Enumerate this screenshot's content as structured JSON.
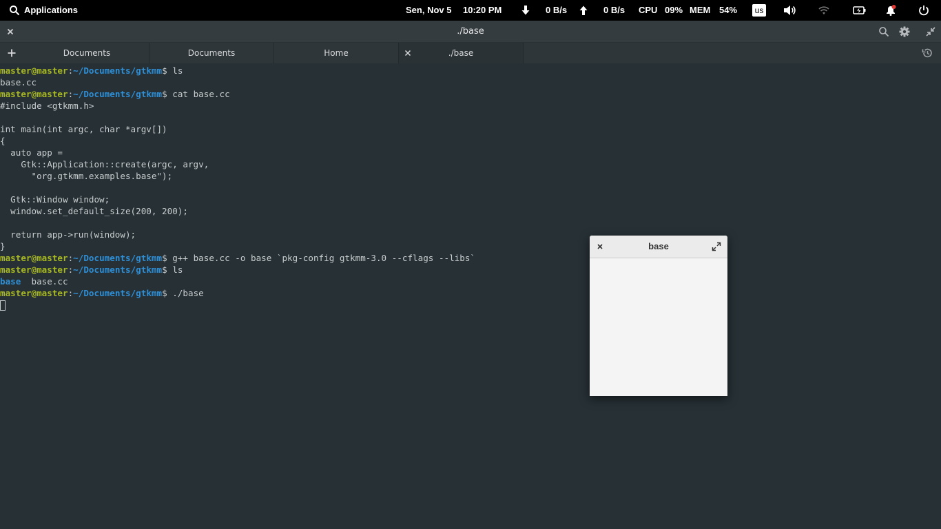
{
  "panel": {
    "applications_label": "Applications",
    "date": "Sen, Nov  5",
    "time": "10:20 PM",
    "download_rate": "0  B/s",
    "upload_rate": "0  B/s",
    "cpu_label": "CPU",
    "cpu_value": "09%",
    "mem_label": "MEM",
    "mem_value": "54%",
    "keyboard_layout": "us"
  },
  "terminal_window": {
    "title": "./base",
    "tabs": [
      {
        "label": "Documents"
      },
      {
        "label": "Documents"
      },
      {
        "label": "Home"
      },
      {
        "label": "./base"
      }
    ]
  },
  "terminal": {
    "user": "master@master",
    "path": "~/Documents/gtkmm",
    "lines": [
      {
        "type": "prompt",
        "cmd": " ls"
      },
      {
        "type": "out",
        "text": "base.cc"
      },
      {
        "type": "prompt",
        "cmd": " cat base.cc"
      },
      {
        "type": "out",
        "text": "#include <gtkmm.h>"
      },
      {
        "type": "out",
        "text": ""
      },
      {
        "type": "out",
        "text": "int main(int argc, char *argv[])"
      },
      {
        "type": "out",
        "text": "{"
      },
      {
        "type": "out",
        "text": "  auto app ="
      },
      {
        "type": "out",
        "text": "    Gtk::Application::create(argc, argv,"
      },
      {
        "type": "out",
        "text": "      \"org.gtkmm.examples.base\");"
      },
      {
        "type": "out",
        "text": ""
      },
      {
        "type": "out",
        "text": "  Gtk::Window window;"
      },
      {
        "type": "out",
        "text": "  window.set_default_size(200, 200);"
      },
      {
        "type": "out",
        "text": ""
      },
      {
        "type": "out",
        "text": "  return app->run(window);"
      },
      {
        "type": "out",
        "text": "}"
      },
      {
        "type": "prompt",
        "cmd": " g++ base.cc -o base `pkg-config gtkmm-3.0 --cflags --libs`"
      },
      {
        "type": "prompt",
        "cmd": " ls"
      },
      {
        "type": "dirlist",
        "dir": "base",
        "rest": "  base.cc"
      },
      {
        "type": "prompt",
        "cmd": " ./base"
      },
      {
        "type": "cursor"
      }
    ]
  },
  "gtk_window": {
    "title": "base"
  },
  "colors": {
    "terminal_bg": "#263035",
    "user_green": "#a8b822",
    "path_blue": "#2f8fd6",
    "notification_red": "#e53935"
  }
}
